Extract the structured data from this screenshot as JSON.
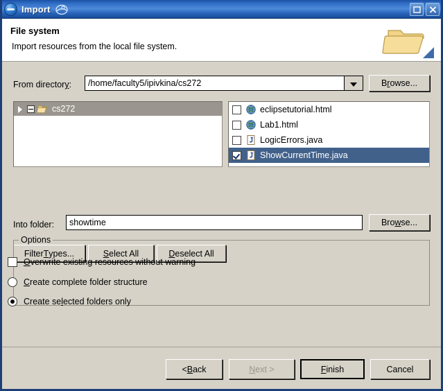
{
  "window": {
    "title": "Import",
    "app_icon": "eclipse-import-icon",
    "swirl_icon": "eclipse-swirl-icon",
    "controls": [
      {
        "name": "maximize-button",
        "icon": "maximize-icon"
      },
      {
        "name": "close-button",
        "icon": "close-icon"
      }
    ],
    "accent_titlebar": "#2f6cc4",
    "background": "#d6d2c8"
  },
  "header": {
    "title": "File system",
    "description": "Import resources from the local file system.",
    "icon": "folder-banner-icon"
  },
  "from_directory": {
    "label_before": "From director",
    "label_mnemonic": "y",
    "label_after": ":",
    "value": "/home/faculty5/ipivkina/cs272",
    "dropdown_icon": "chevron-down-icon",
    "browse_before": "B",
    "browse_mnemonic": "r",
    "browse_after": "owse..."
  },
  "tree": {
    "items": [
      {
        "label": "cs272",
        "icon": "open-folder-icon",
        "expander": "collapse-minus-icon",
        "arrow": "triangle-right-icon",
        "selected": true
      }
    ]
  },
  "files": [
    {
      "name": "eclipsetutorial.html",
      "icon": "html-globe-icon",
      "checked": false,
      "selected": false
    },
    {
      "name": "Lab1.html",
      "icon": "html-globe-icon",
      "checked": false,
      "selected": false
    },
    {
      "name": "LogicErrors.java",
      "icon": "java-file-icon",
      "checked": false,
      "selected": false
    },
    {
      "name": "ShowCurrentTime.java",
      "icon": "java-file-icon",
      "checked": true,
      "selected": true
    }
  ],
  "selection_buttons": {
    "filter_before": "Filter ",
    "filter_mnemonic": "T",
    "filter_after": "ypes...",
    "select_mnemonic": "S",
    "select_after": "elect All",
    "deselect_mnemonic": "D",
    "deselect_after": "eselect All"
  },
  "into_folder": {
    "label": "Into folder:",
    "value": "showtime",
    "browse_before": "Bro",
    "browse_mnemonic": "w",
    "browse_after": "se..."
  },
  "options": {
    "legend": "Options",
    "overwrite": {
      "mnemonic": "O",
      "after": "verwrite existing resources without warning",
      "checked": false
    },
    "complete_structure": {
      "mnemonic": "C",
      "after": "reate complete folder structure",
      "selected": false
    },
    "selected_only": {
      "before": "Create se",
      "mnemonic": "l",
      "after": "ected folders only",
      "selected": true
    }
  },
  "footer": {
    "back_before": "< ",
    "back_mnemonic": "B",
    "back_after": "ack",
    "next_mnemonic": "N",
    "next_after": "ext >",
    "next_disabled": true,
    "finish_mnemonic": "F",
    "finish_after": "inish",
    "finish_default": true,
    "cancel_label": "Cancel"
  }
}
